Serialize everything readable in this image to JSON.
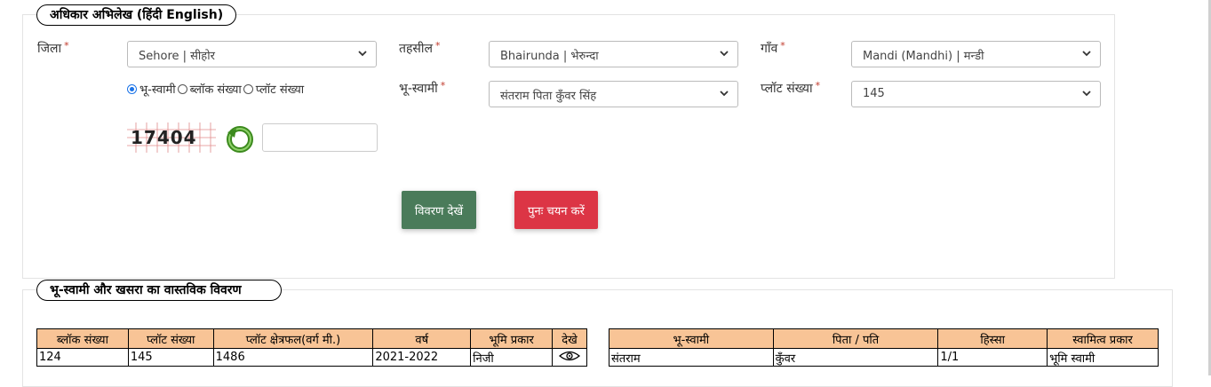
{
  "section1": {
    "legend": "अधिकार अभिलेख  (हिंदी  English)",
    "district": {
      "label": "जिला",
      "value": "Sehore | सीहोर"
    },
    "tehsil": {
      "label": "तहसील",
      "value": "Bhairunda | भेरुन्दा"
    },
    "village": {
      "label": "गाँव",
      "value": "Mandi (Mandhi) | मन्डी"
    },
    "owner": {
      "label": "भू-स्वामी",
      "value": "संतराम पिता कुँवर सिंह"
    },
    "plot": {
      "label": "प्लॉट संख्या",
      "value": "145"
    },
    "search_by": {
      "options": [
        "भू-स्वामी",
        "ब्लॉक संख्या",
        "प्लॉट संख्या"
      ],
      "selected": "भू-स्वामी"
    },
    "captcha": {
      "text": "17404",
      "input_value": ""
    },
    "buttons": {
      "view": "विवरण देखें",
      "reset": "पुनः चयन करें"
    },
    "required_mark": "*"
  },
  "section2": {
    "legend": "भू-स्वामी और खसरा का वास्तविक विवरण",
    "plot_table": {
      "headers": [
        "ब्लॉक संख्या",
        "प्लॉट संख्या",
        "प्लॉट क्षेत्रफल(वर्ग मी.)",
        "वर्ष",
        "भूमि प्रकार",
        "देखे"
      ],
      "rows": [
        [
          "124",
          "145",
          "1486",
          "2021-2022",
          "निजी",
          "eye-icon"
        ]
      ]
    },
    "owner_table": {
      "headers": [
        "भू-स्वामी",
        "पिता / पति",
        "हिस्सा",
        "स्वामित्व प्रकार"
      ],
      "rows": [
        [
          "संतराम",
          "कुँवर",
          "1/1",
          "भूमि स्वामी"
        ]
      ]
    }
  },
  "colors": {
    "header_bg": "#f8c496",
    "view_button": "#4a7b5a",
    "reset_button": "#dc3545",
    "radio_accent": "#1a73e8"
  }
}
